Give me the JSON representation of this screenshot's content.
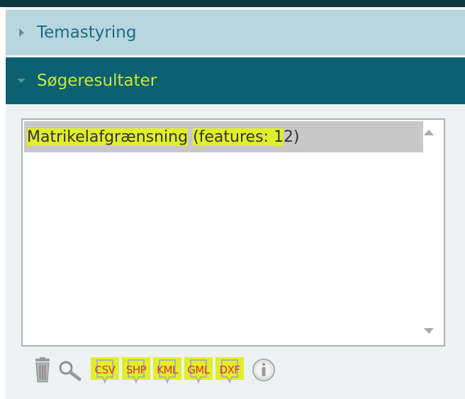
{
  "accordion": {
    "sections": [
      {
        "label": "Temastyring",
        "expanded": false,
        "icon": "triangle-right-icon"
      },
      {
        "label": "Søgeresultater",
        "expanded": true,
        "icon": "triangle-down-icon"
      }
    ]
  },
  "results": {
    "items": [
      {
        "name": "Matrikelafgrænsning",
        "count_label": "(features: 1",
        "count_tail": "2)"
      }
    ]
  },
  "toolbar": {
    "tools": [
      {
        "name": "trash-icon"
      },
      {
        "name": "search-icon"
      }
    ],
    "exports": [
      {
        "label": "CSV"
      },
      {
        "label": "SHP"
      },
      {
        "label": "KML"
      },
      {
        "label": "GML"
      },
      {
        "label": "DXF"
      }
    ],
    "info_icon": "info-icon"
  },
  "colors": {
    "header_dark": "#0b6072",
    "header_light": "#b8d6de",
    "accent_green": "#c7e83c",
    "highlight": "#e0ef2b",
    "export_red": "#e0302c"
  }
}
